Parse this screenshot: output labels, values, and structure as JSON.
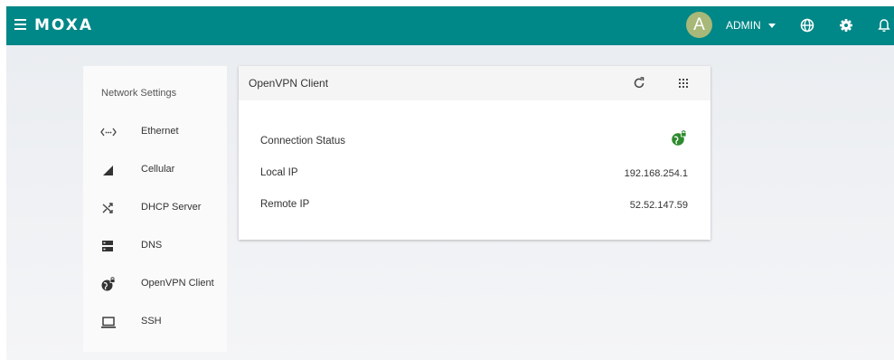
{
  "topbar": {
    "brand": "MOXA",
    "avatar_initial": "A",
    "user_name": "ADMIN",
    "accent_color": "#008787"
  },
  "sidebar": {
    "title": "Network Settings",
    "items": [
      {
        "label": "Ethernet",
        "icon": "ethernet-icon"
      },
      {
        "label": "Cellular",
        "icon": "cellular-signal-icon"
      },
      {
        "label": "DHCP Server",
        "icon": "shuffle-icon"
      },
      {
        "label": "DNS",
        "icon": "server-icon"
      },
      {
        "label": "OpenVPN Client",
        "icon": "vpn-globe-lock-icon"
      },
      {
        "label": "SSH",
        "icon": "laptop-icon"
      }
    ]
  },
  "card": {
    "title": "OpenVPN Client",
    "rows": [
      {
        "label": "Connection Status",
        "value": ""
      },
      {
        "label": "Local IP",
        "value": "192.168.254.1"
      },
      {
        "label": "Remote IP",
        "value": "52.52.147.59"
      }
    ],
    "status_color": "#2e8b2e"
  }
}
